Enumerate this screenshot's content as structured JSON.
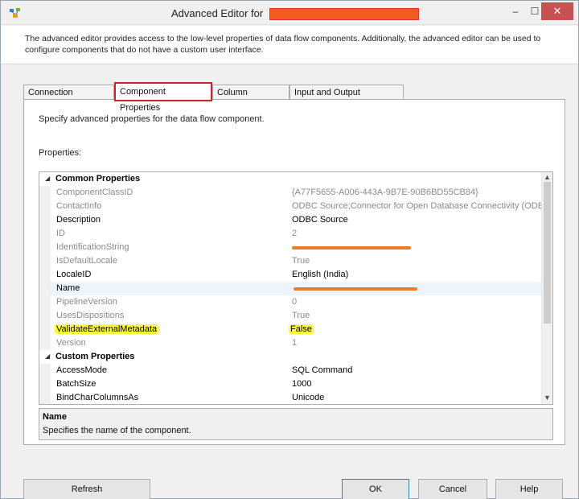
{
  "window": {
    "title": "Advanced Editor for",
    "minimize_glyph": "–",
    "maximize_glyph": "☐",
    "close_glyph": "✕"
  },
  "description": "The advanced editor provides access to the low-level properties of data flow components. Additionally, the advanced editor can be used to configure components that do not have a custom user interface.",
  "tabs": [
    {
      "label": "Connection Managers"
    },
    {
      "label": "Component Properties",
      "active": true
    },
    {
      "label": "Column Mappings"
    },
    {
      "label": "Input and Output Properties"
    }
  ],
  "panel": {
    "heading": "Specify advanced properties for the data flow component.",
    "properties_label": "Properties:"
  },
  "property_grid": {
    "categories": [
      {
        "name": "Common Properties",
        "properties": [
          {
            "name": "ComponentClassID",
            "value": "{A77F5655-A006-443A-9B7E-90B6BD55CB84}",
            "readonly": true
          },
          {
            "name": "ContactInfo",
            "value": "ODBC Source;Connector for Open Database Connectivity (ODBC)",
            "readonly": true
          },
          {
            "name": "Description",
            "value": "ODBC Source",
            "readonly": false
          },
          {
            "name": "ID",
            "value": "2",
            "readonly": true
          },
          {
            "name": "IdentificationString",
            "value": "",
            "readonly": true,
            "redacted": true
          },
          {
            "name": "IsDefaultLocale",
            "value": "True",
            "readonly": true
          },
          {
            "name": "LocaleID",
            "value": "English (India)",
            "readonly": false
          },
          {
            "name": "Name",
            "value": "",
            "readonly": false,
            "redacted": true,
            "selected": true
          },
          {
            "name": "PipelineVersion",
            "value": "0",
            "readonly": true
          },
          {
            "name": "UsesDispositions",
            "value": "True",
            "readonly": true
          },
          {
            "name": "ValidateExternalMetadata",
            "value": "False",
            "readonly": false,
            "highlighted": true
          },
          {
            "name": "Version",
            "value": "1",
            "readonly": true
          }
        ]
      },
      {
        "name": "Custom Properties",
        "properties": [
          {
            "name": "AccessMode",
            "value": "SQL Command",
            "readonly": false
          },
          {
            "name": "BatchSize",
            "value": "1000",
            "readonly": false
          },
          {
            "name": "BindCharColumnsAs",
            "value": "Unicode",
            "readonly": false
          }
        ]
      }
    ]
  },
  "help": {
    "title": "Name",
    "description": "Specifies the name of the component."
  },
  "buttons": {
    "refresh": "Refresh",
    "ok": "OK",
    "cancel": "Cancel",
    "help": "Help"
  },
  "colors": {
    "close_button": "#c75050",
    "active_tab_outline": "#d0202a",
    "redaction": "#f25a1e",
    "highlight": "#fbfb3a"
  }
}
